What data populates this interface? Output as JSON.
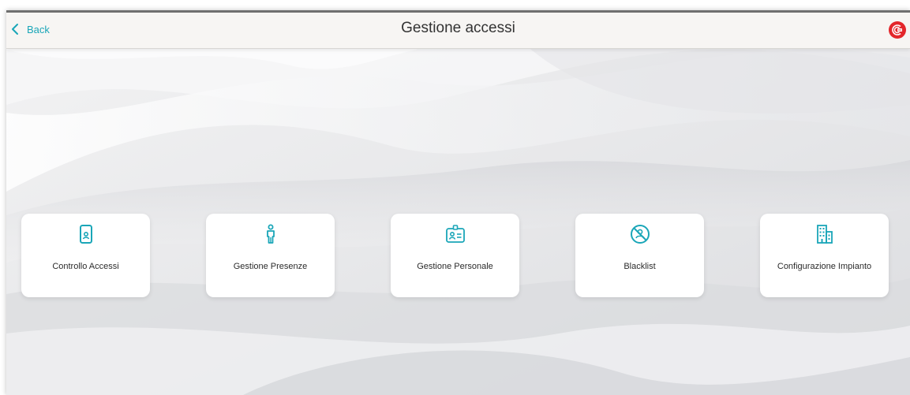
{
  "header": {
    "back_label": "Back",
    "title": "Gestione accessi"
  },
  "tiles": [
    {
      "label": "Controllo Accessi",
      "icon": "tablet-icon"
    },
    {
      "label": "Gestione Presenze",
      "icon": "person-icon"
    },
    {
      "label": "Gestione Personale",
      "icon": "id-card-icon"
    },
    {
      "label": "Blacklist",
      "icon": "blacklist-icon"
    },
    {
      "label": "Configurazione Impianto",
      "icon": "building-icon"
    }
  ],
  "colors": {
    "accent": "#1aa6b8",
    "brand": "#e3262b",
    "header_bg": "#f7f5f3",
    "background": "#e9eaed"
  }
}
